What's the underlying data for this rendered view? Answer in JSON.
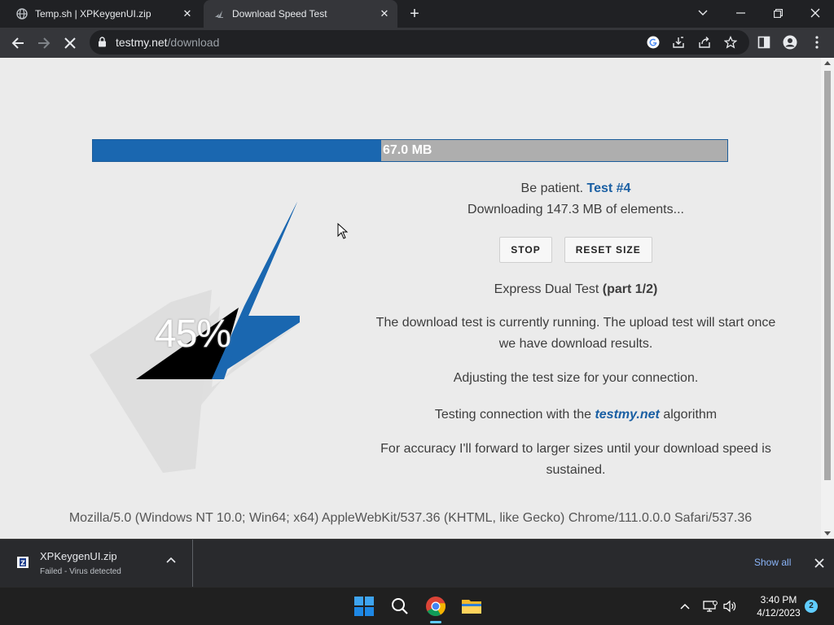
{
  "browser": {
    "tabs": [
      {
        "title": "Temp.sh | XPKeygenUI.zip",
        "favicon": "globe-icon",
        "active": false
      },
      {
        "title": "Download Speed Test",
        "favicon": "testmy-icon",
        "active": true
      }
    ],
    "new_tab": "+",
    "address": {
      "host": "testmy.net",
      "path": "/download"
    },
    "loading": true
  },
  "page": {
    "progress": {
      "fraction": 0.455,
      "label": "67.0 MB"
    },
    "percent": "45%",
    "patience": "Be patient.",
    "test_number": "Test #4",
    "downloading": "Downloading 147.3 MB of elements...",
    "buttons": {
      "stop": "STOP",
      "reset": "RESET SIZE"
    },
    "express_prefix": "Express Dual Test ",
    "express_part": "(part 1/2)",
    "running_msg": "The download test is currently running. The upload test will start once we have download results.",
    "adjusting_msg": "Adjusting the test size for your connection.",
    "testing_prefix": "Testing connection with the ",
    "brand": "testmy.net",
    "testing_suffix": " algorithm",
    "accuracy_msg": "For accuracy I'll forward to larger sizes until your download speed is sustained.",
    "user_agent": "Mozilla/5.0 (Windows NT 10.0; Win64; x64) AppleWebKit/537.36 (KHTML, like Gecko) Chrome/111.0.0.0 Safari/537.36"
  },
  "downloads": {
    "file_name": "XPKeygenUI.zip",
    "status": "Failed - Virus detected",
    "show_all": "Show all"
  },
  "taskbar": {
    "time": "3:40 PM",
    "date": "4/12/2023",
    "notifications": "2"
  },
  "colors": {
    "accent_blue": "#1a67b0",
    "progress_bg": "#aeaeae",
    "link_blue": "#8ab4f8"
  }
}
